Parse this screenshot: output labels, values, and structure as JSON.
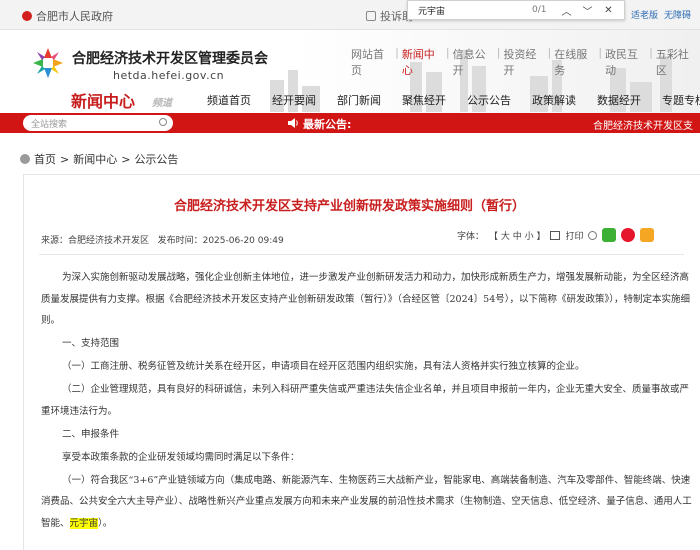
{
  "topbar": {
    "gov_site": "合肥市人民政府",
    "help_label": "投诉助",
    "find": {
      "query": "元宇宙",
      "count": "0/1",
      "prev": "︿",
      "next": "﹀",
      "close": "✕"
    },
    "accessibility": {
      "elder": "适老版",
      "barrier_free": "无障碍"
    }
  },
  "header": {
    "title": "合肥经济技术开发区管理委员会",
    "url": "hetda.hefei.gov.cn",
    "channel": "新闻中心",
    "channel_sub": "频道",
    "top_links": [
      "网站首页",
      "新闻中心",
      "信息公开",
      "投资经开",
      "在线服务",
      "政民互动",
      "五彩社区"
    ],
    "active_link": "新闻中心",
    "nav": [
      "频道首页",
      "经开要闻",
      "部门新闻",
      "聚焦经开",
      "公示公告",
      "政策解读",
      "数据经开",
      "专题专栏"
    ]
  },
  "redbar": {
    "search_placeholder": "全站搜索",
    "notice_label": "最新公告:",
    "notice_text": "合肥经济技术开发区支"
  },
  "breadcrumb": [
    "首页",
    "新闻中心",
    "公示公告"
  ],
  "article": {
    "title": "合肥经济技术开发区支持产业创新研发政策实施细则（暂行）",
    "source": "来源：合肥经济技术开发区",
    "published": "发布时间：2025-06-20 09:49",
    "font_label": "字体：",
    "font_sizes": "【 大 中 小 】",
    "print_label": "打印",
    "paragraphs": [
      "为深入实施创新驱动发展战略，强化企业创新主体地位，进一步激发产业创新研发活力和动力，加快形成新质生产力，增强发展新动能，为全区经济高质量发展提供有力支撑。根据《合肥经济技术开发区支持产业创新研发政策（暂行）》（合经区管〔2024〕54号），以下简称《研发政策》），特制定本实施细则。",
      "一、支持范围",
      "（一）工商注册、税务征管及统计关系在经开区，申请项目在经开区范围内组织实施，具有法人资格并实行独立核算的企业。",
      "（二）企业管理规范，具有良好的科研诚信，未列入科研严重失信或严重违法失信企业名单，并且项目申报前一年内，企业无重大安全、质量事故或严重环境违法行为。",
      "二、申报条件",
      "享受本政策条款的企业研发领域均需同时满足以下条件："
    ],
    "last_paragraph": "（一）符合我区“3+6”产业链领域方向（集成电路、新能源汽车、生物医药三大战新产业，智能家电、高端装备制造、汽车及零部件、智能终端、快速消费品、公共安全六大主导产业）、战略性新兴产业重点发展方向和未来产业发展的前沿性技术需求（生物制造、空天信息、低空经济、量子信息、通用人工智能、",
    "highlight": "元宇宙",
    "last_tail": "）。"
  },
  "colors": {
    "accent_red": "#d11414",
    "title_red": "#c81e1e",
    "wechat": "#3cb034",
    "weibo": "#e6162d",
    "qzone": "#f5a623"
  }
}
